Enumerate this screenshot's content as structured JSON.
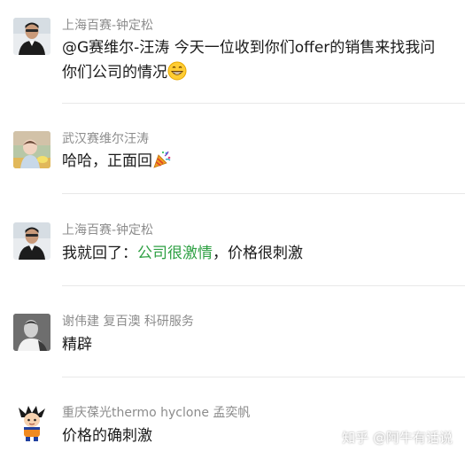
{
  "messages": [
    {
      "sender": "上海百赛-钟定松",
      "line1": "@G赛维尔-汪涛 今天一位收到你们offer的销售来找我问",
      "line2": "你们公司的情况",
      "emoji": "grinning-face-emoji"
    },
    {
      "sender": "武汉赛维尔汪涛",
      "text": "哈哈，正面回",
      "emoji": "party-popper-emoji"
    },
    {
      "sender": "上海百赛-钟定松",
      "text_before": "我就回了：",
      "text_highlight": "公司很激情",
      "text_after": "，价格很刺激",
      "highlight_color": "#2ea043"
    },
    {
      "sender": "谢伟建 复百澳 科研服务",
      "text": "精辟"
    },
    {
      "sender": "重庆葆光thermo hyclone 孟奕帆",
      "text": "价格的确刺激"
    }
  ],
  "watermark": "知乎 @阿牛有话说"
}
